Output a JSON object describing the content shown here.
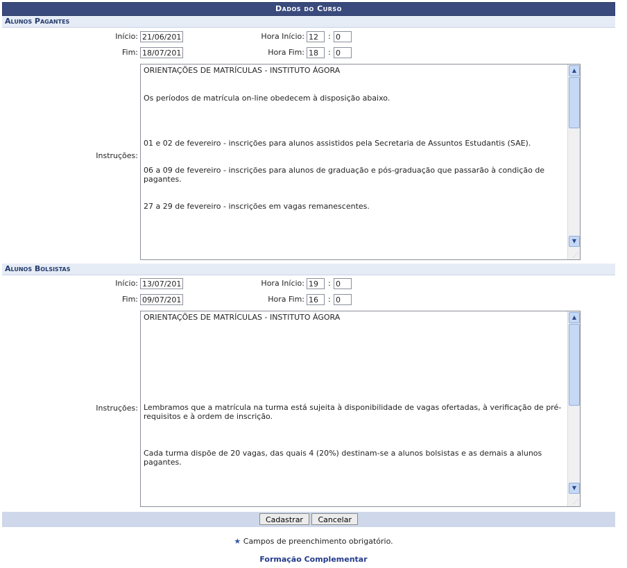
{
  "caption": "Dados do Curso",
  "pagantes": {
    "title": "Alunos Pagantes",
    "inicio_label": "Início:",
    "inicio_value": "21/06/201",
    "fim_label": "Fim:",
    "fim_value": "18/07/201",
    "hora_inicio_label": "Hora Início:",
    "hora_inicio_h": "12",
    "hora_inicio_m": "0",
    "hora_fim_label": "Hora Fim:",
    "hora_fim_h": "18",
    "hora_fim_m": "0",
    "instrucoes_label": "Instruções:",
    "instrucoes": [
      "ORIENTAÇÕES DE MATRÍCULAS - INSTITUTO ÁGORA",
      "Os períodos de matrícula on-line obedecem à disposição abaixo.",
      "01 e 02 de fevereiro - inscrições para alunos assistidos pela Secretaria de Assuntos Estudantis (SAE).",
      "06 a 09 de fevereiro - inscrições para alunos de graduação e pós-graduação que passarão à condição de pagantes.",
      "27 a 29 de fevereiro - inscrições em vagas remanescentes."
    ]
  },
  "bolsistas": {
    "title": "Alunos Bolsistas",
    "inicio_label": "Início:",
    "inicio_value": "13/07/201",
    "fim_label": "Fim:",
    "fim_value": "09/07/201",
    "hora_inicio_label": "Hora Início:",
    "hora_inicio_h": "19",
    "hora_inicio_m": "0",
    "hora_fim_label": "Hora Fim:",
    "hora_fim_h": "16",
    "hora_fim_m": "0",
    "instrucoes_label": "Instruções:",
    "instrucoes": [
      "ORIENTAÇÕES DE MATRÍCULAS - INSTITUTO ÁGORA",
      "Lembramos que a matrícula na turma está sujeita à disponibilidade de vagas ofertadas, à verificação de pré-requisitos e à ordem de inscrição.",
      "Cada turma dispõe de 20 vagas, das quais 4 (20%) destinam-se a alunos bolsistas e as demais a alunos pagantes."
    ]
  },
  "colon": ":",
  "buttons": {
    "cadastrar": "Cadastrar",
    "cancelar": "Cancelar"
  },
  "required_note": "Campos de preenchimento obrigatório.",
  "required_star": "★",
  "nav_link": "Formação Complementar",
  "colors": {
    "caption_bg": "#3a4a7c",
    "section_bg": "#e6ecf6",
    "footer_bg": "#cfd8ea",
    "link": "#233a8b"
  }
}
